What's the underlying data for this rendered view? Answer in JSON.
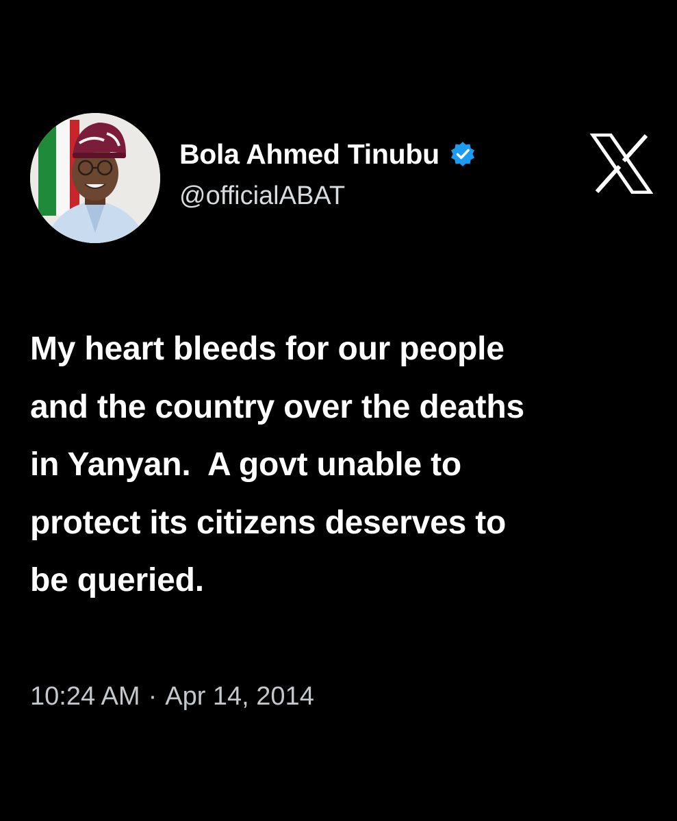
{
  "account": {
    "display_name": "Bola Ahmed Tinubu",
    "handle": "@officialABAT",
    "verified": true,
    "verified_badge_color": "#1d9bf0",
    "avatar_icon": "profile-photo"
  },
  "brand": {
    "logo_icon": "x-logo-icon"
  },
  "tweet": {
    "text": "My heart bleeds for our people\nand the country over the deaths\nin Yanyan.  A govt unable to\nprotect its citizens deserves to\nbe queried.",
    "time": "10:24 AM",
    "separator": "·",
    "date": "Apr 14, 2014"
  },
  "colors": {
    "background": "#000000",
    "text": "#ffffff",
    "secondary_text": "#c4c8cc"
  }
}
